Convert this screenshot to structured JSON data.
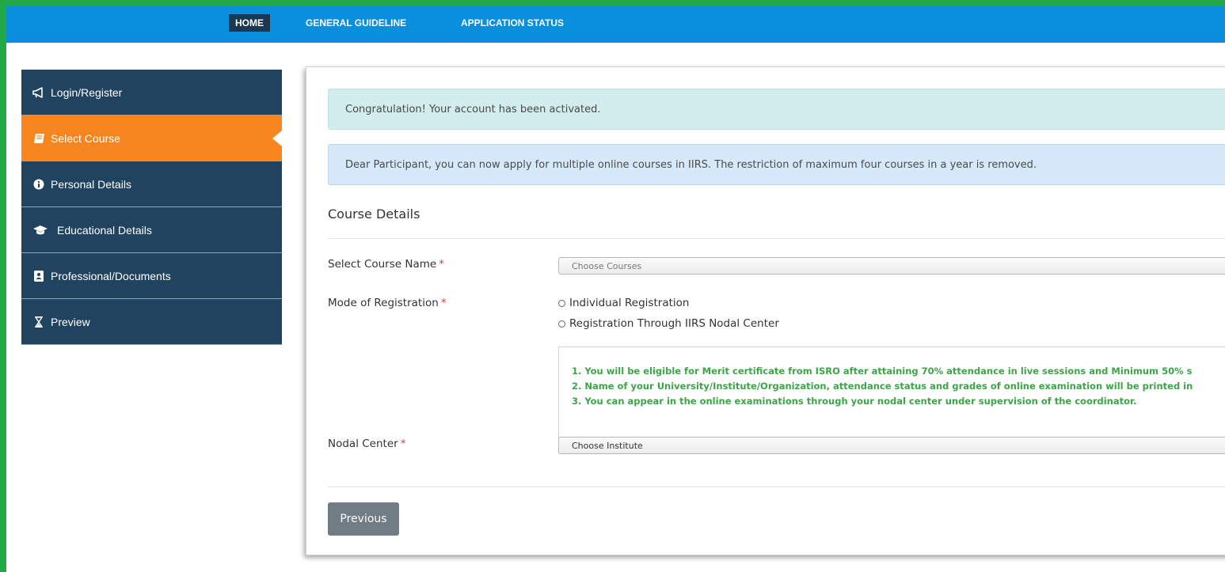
{
  "nav": {
    "items": [
      {
        "label": "HOME",
        "active": true
      },
      {
        "label": "GENERAL GUIDELINE",
        "active": false
      },
      {
        "label": "APPLICATION STATUS",
        "active": false
      }
    ]
  },
  "sidebar": {
    "items": [
      {
        "label": "Login/Register",
        "icon": "megaphone-icon",
        "active": false
      },
      {
        "label": "Select Course",
        "icon": "book-icon",
        "active": true
      },
      {
        "label": "Personal Details",
        "icon": "info-circle-icon",
        "active": false
      },
      {
        "label": "Educational Details",
        "icon": "graduation-cap-icon",
        "active": false
      },
      {
        "label": "Professional/Documents",
        "icon": "contact-book-icon",
        "active": false
      },
      {
        "label": "Preview",
        "icon": "hourglass-icon",
        "active": false
      }
    ]
  },
  "alerts": {
    "success": "Congratulation! Your account has been activated.",
    "info": "Dear Participant, you can now apply for multiple online courses in IIRS. The restriction of maximum four courses in a year is removed."
  },
  "form": {
    "section_title": "Course Details",
    "course_label": "Select Course Name",
    "course_placeholder": "Choose Courses",
    "mode_label": "Mode of Registration",
    "mode_options": [
      "Individual Registration",
      "Registration Through IIRS Nodal Center"
    ],
    "notes": [
      "1. You will be eligible for Merit certificate from ISRO after attaining 70% attendance in live sessions and Minimum 50% s",
      "2. Name of your University/Institute/Organization, attendance status and grades of online examination will be printed in",
      "3. You can appear in the online examinations through your nodal center under supervision of the coordinator."
    ],
    "nodal_label": "Nodal Center",
    "nodal_placeholder": "Choose Institute",
    "required_marker": "*",
    "previous_label": "Previous"
  },
  "colors": {
    "nav_bg": "#0a8fdd",
    "sidebar_bg": "#20435f",
    "sidebar_active": "#f7861f",
    "note_text": "#3aa646",
    "frame_border": "#22a846"
  }
}
